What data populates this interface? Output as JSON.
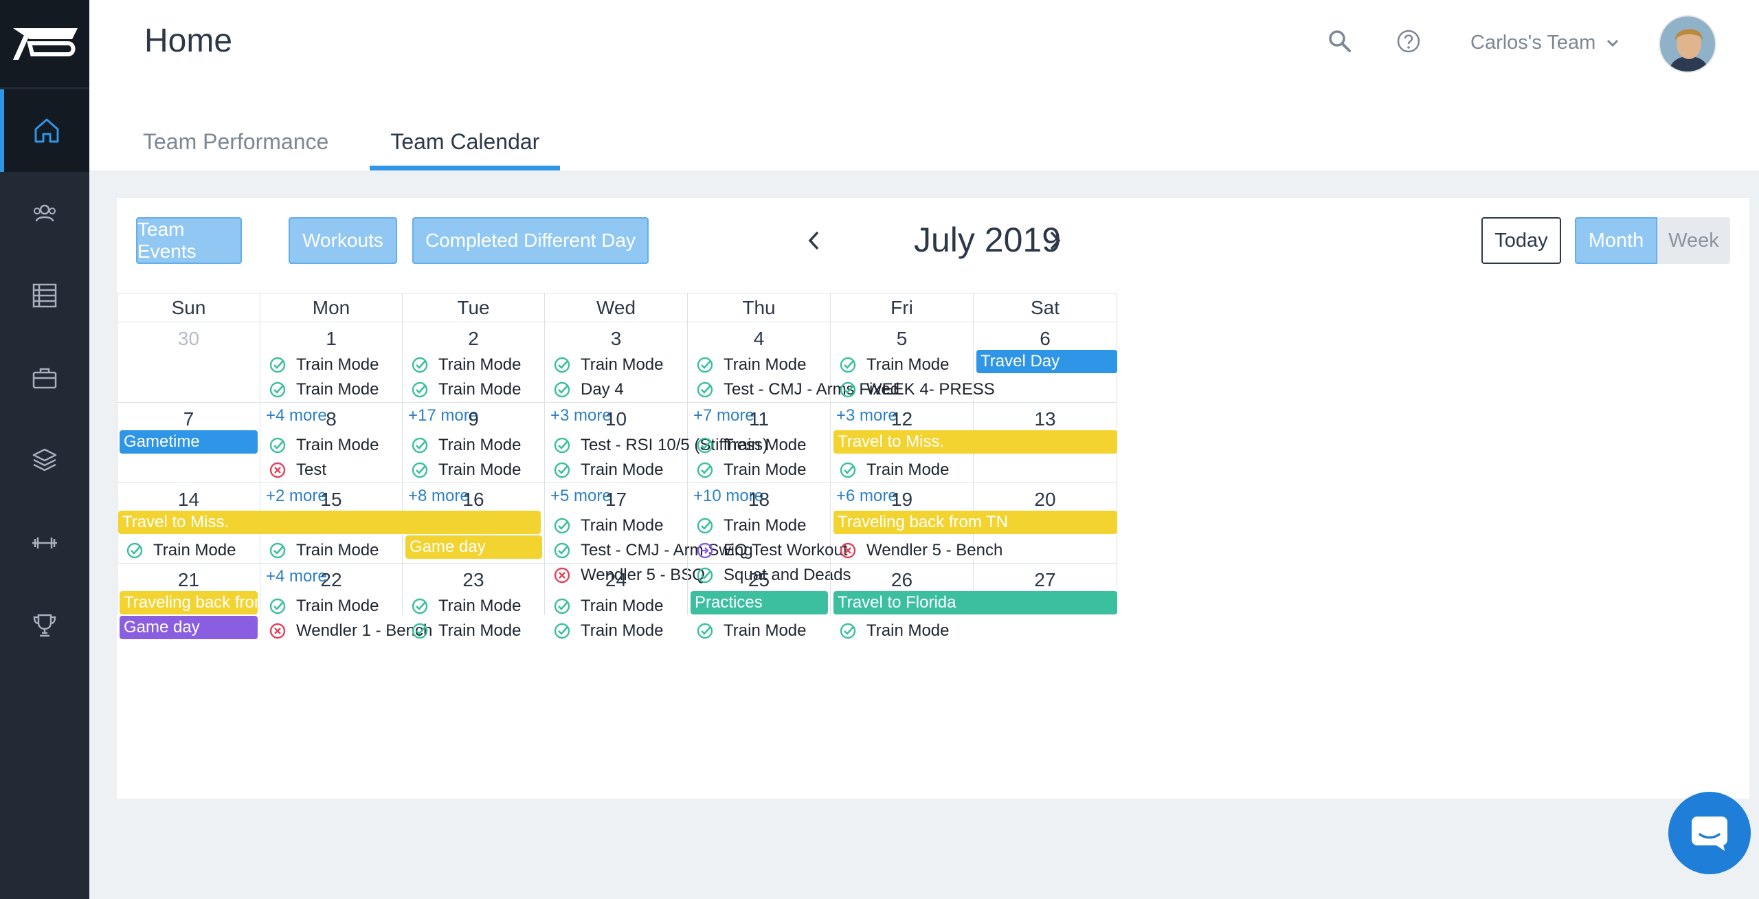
{
  "header": {
    "title": "Home",
    "team_name": "Carlos's Team",
    "tabs": [
      {
        "label": "Team Performance",
        "active": false
      },
      {
        "label": "Team Calendar",
        "active": true
      }
    ]
  },
  "sidebar": {
    "items": [
      {
        "icon": "home-icon",
        "active": true
      },
      {
        "icon": "users-icon",
        "active": false
      },
      {
        "icon": "table-icon",
        "active": false
      },
      {
        "icon": "briefcase-icon",
        "active": false
      },
      {
        "icon": "layers-icon",
        "active": false
      },
      {
        "icon": "dumbbell-icon",
        "active": false
      },
      {
        "icon": "trophy-icon",
        "active": false
      }
    ]
  },
  "toolbar": {
    "filters": [
      "Team Events",
      "Workouts",
      "Completed Different Day"
    ],
    "month_label": "July 2019",
    "today_label": "Today",
    "view_month": "Month",
    "view_week": "Week"
  },
  "calendar": {
    "weekdays": [
      "Sun",
      "Mon",
      "Tue",
      "Wed",
      "Thu",
      "Fri",
      "Sat"
    ],
    "weeks": [
      {
        "days": [
          {
            "num": "30",
            "muted": true,
            "items": [],
            "more": ""
          },
          {
            "num": "1",
            "items": [
              {
                "status": "done",
                "text": "Train Mode"
              },
              {
                "status": "done",
                "text": "Train Mode"
              }
            ],
            "more": "+4 more"
          },
          {
            "num": "2",
            "items": [
              {
                "status": "done",
                "text": "Train Mode"
              },
              {
                "status": "done",
                "text": "Train Mode"
              }
            ],
            "more": "+17 more"
          },
          {
            "num": "3",
            "items": [
              {
                "status": "done",
                "text": "Train Mode"
              },
              {
                "status": "done",
                "text": "Day 4"
              }
            ],
            "more": "+3 more"
          },
          {
            "num": "4",
            "items": [
              {
                "status": "done",
                "text": "Train Mode"
              },
              {
                "status": "done",
                "text": "Test - CMJ - Arms Fixed"
              }
            ],
            "more": "+7 more"
          },
          {
            "num": "5",
            "items": [
              {
                "status": "done",
                "text": "Train Mode"
              },
              {
                "status": "done",
                "text": "WEEK 4- PRESS"
              }
            ],
            "more": "+3 more"
          },
          {
            "num": "6",
            "items": [],
            "more": ""
          }
        ],
        "bars": [
          {
            "text": "Travel Day",
            "color": "blue",
            "start": 6,
            "span": 1,
            "row": 0
          }
        ]
      },
      {
        "days": [
          {
            "num": "7",
            "items": [],
            "more": ""
          },
          {
            "num": "8",
            "items": [
              {
                "status": "done",
                "text": "Train Mode"
              },
              {
                "status": "missed",
                "text": "Test"
              }
            ],
            "more": "+2 more"
          },
          {
            "num": "9",
            "items": [
              {
                "status": "done",
                "text": "Train Mode"
              },
              {
                "status": "done",
                "text": "Train Mode"
              }
            ],
            "more": "+8 more"
          },
          {
            "num": "10",
            "items": [
              {
                "status": "done",
                "text": "Test - RSI 10/5 (Stiffness)"
              },
              {
                "status": "done",
                "text": "Train Mode"
              }
            ],
            "more": "+5 more"
          },
          {
            "num": "11",
            "items": [
              {
                "status": "done",
                "text": "Train Mode"
              },
              {
                "status": "done",
                "text": "Train Mode"
              }
            ],
            "more": "+10 more"
          },
          {
            "num": "12",
            "items": [
              {
                "status": "none",
                "text": ""
              },
              {
                "status": "done",
                "text": "Train Mode"
              }
            ],
            "more": "+6 more"
          },
          {
            "num": "13",
            "items": [],
            "more": ""
          }
        ],
        "bars": [
          {
            "text": "Gametime",
            "color": "blue",
            "start": 0,
            "span": 1,
            "row": 0
          },
          {
            "text": "Travel to Miss.",
            "color": "yellow",
            "start": 5,
            "span": 2,
            "row": 0
          }
        ]
      },
      {
        "days": [
          {
            "num": "14",
            "items": [
              {
                "status": "none",
                "text": ""
              },
              {
                "status": "done",
                "text": "Train Mode"
              }
            ],
            "more": ""
          },
          {
            "num": "15",
            "items": [
              {
                "status": "none",
                "text": ""
              },
              {
                "status": "done",
                "text": "Train Mode"
              }
            ],
            "more": "+4 more"
          },
          {
            "num": "16",
            "items": [],
            "more": ""
          },
          {
            "num": "17",
            "items": [
              {
                "status": "done",
                "text": "Train Mode"
              },
              {
                "status": "done",
                "text": "Test - CMJ - Arm Swing"
              },
              {
                "status": "missed",
                "text": "Wendler 5 - BSQ"
              }
            ],
            "more": ""
          },
          {
            "num": "18",
            "items": [
              {
                "status": "done",
                "text": "Train Mode"
              },
              {
                "status": "different",
                "text": "EQ Test Workout"
              },
              {
                "status": "done",
                "text": "Squat and Deads"
              }
            ],
            "more": ""
          },
          {
            "num": "19",
            "items": [
              {
                "status": "none",
                "text": ""
              },
              {
                "status": "missed",
                "text": "Wendler 5 - Bench"
              }
            ],
            "more": ""
          },
          {
            "num": "20",
            "items": [],
            "more": ""
          }
        ],
        "bars": [
          {
            "text": "Travel to Miss.",
            "color": "yellow",
            "start": 0,
            "span": 3,
            "row": 0
          },
          {
            "text": "Game day",
            "color": "yellow",
            "start": 2,
            "span": 1,
            "row": 1
          },
          {
            "text": "Traveling back from TN",
            "color": "yellow",
            "start": 5,
            "span": 2,
            "row": 0
          }
        ]
      },
      {
        "days": [
          {
            "num": "21",
            "items": [],
            "more": ""
          },
          {
            "num": "22",
            "items": [
              {
                "status": "done",
                "text": "Train Mode"
              },
              {
                "status": "missed",
                "text": "Wendler 1 - Bench"
              }
            ],
            "more": ""
          },
          {
            "num": "23",
            "items": [
              {
                "status": "done",
                "text": "Train Mode"
              },
              {
                "status": "done",
                "text": "Train Mode"
              }
            ],
            "more": ""
          },
          {
            "num": "24",
            "items": [
              {
                "status": "done",
                "text": "Train Mode"
              },
              {
                "status": "done",
                "text": "Train Mode"
              }
            ],
            "more": ""
          },
          {
            "num": "25",
            "items": [
              {
                "status": "none",
                "text": ""
              },
              {
                "status": "done",
                "text": "Train Mode"
              }
            ],
            "more": ""
          },
          {
            "num": "26",
            "items": [
              {
                "status": "none",
                "text": ""
              },
              {
                "status": "done",
                "text": "Train Mode"
              }
            ],
            "more": ""
          },
          {
            "num": "27",
            "items": [],
            "more": ""
          }
        ],
        "bars": [
          {
            "text": "Traveling back from TN",
            "color": "yellow",
            "start": 0,
            "span": 1,
            "row": 0
          },
          {
            "text": "Game day",
            "color": "purple",
            "start": 0,
            "span": 1,
            "row": 1
          },
          {
            "text": "Practices",
            "color": "teal",
            "start": 4,
            "span": 1,
            "row": 0
          },
          {
            "text": "Travel to Florida",
            "color": "teal",
            "start": 5,
            "span": 2,
            "row": 0
          }
        ]
      }
    ]
  },
  "colors": {
    "accent": "#2f95e6",
    "done": "#3bbf9f",
    "missed": "#e0425a",
    "different": "#8a5ee0"
  }
}
